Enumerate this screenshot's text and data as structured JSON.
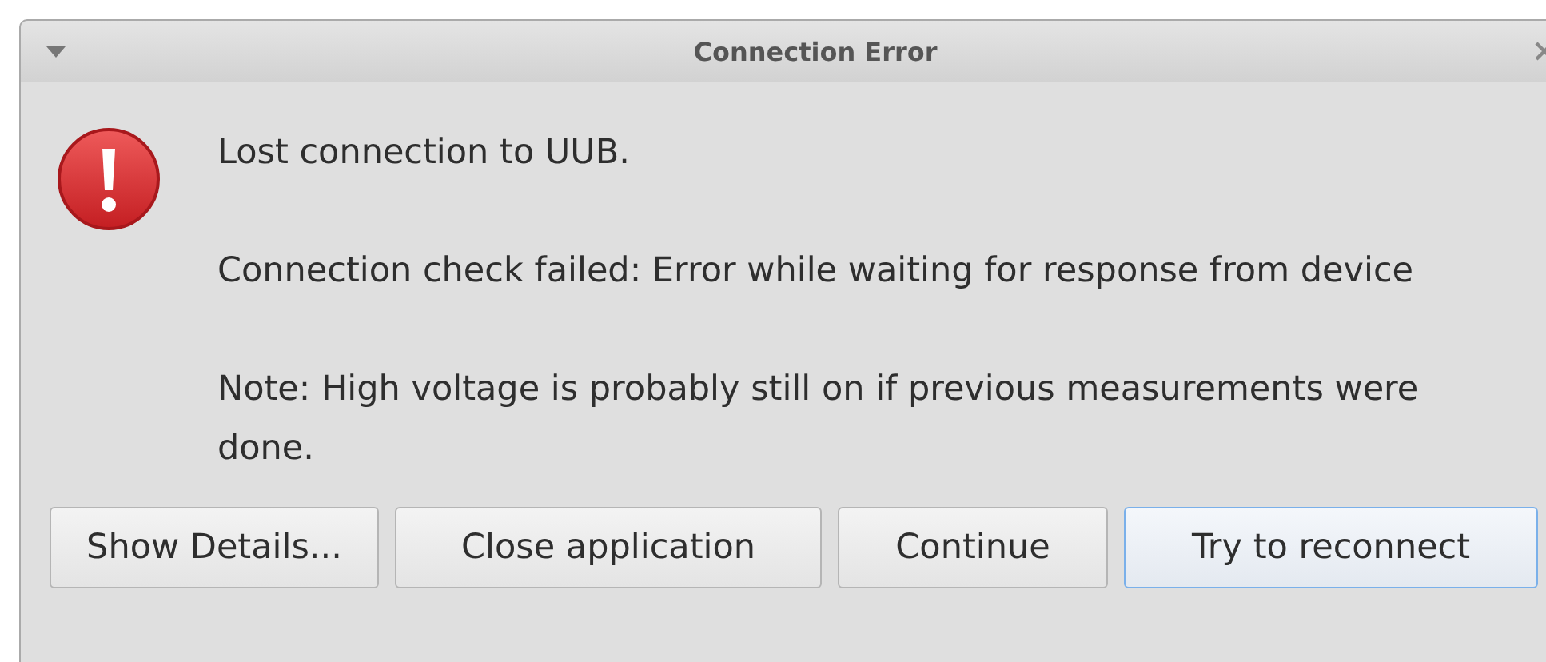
{
  "window": {
    "title": "Connection Error"
  },
  "messages": [
    "Lost connection to UUB.",
    "Connection check failed: Error while waiting for response from device",
    "Note: High voltage is probably still on if previous measurements were done."
  ],
  "buttons": [
    {
      "label": "Show Details...",
      "default": false
    },
    {
      "label": "Close application",
      "default": false
    },
    {
      "label": "Continue",
      "default": false
    },
    {
      "label": "Try to reconnect",
      "default": true
    }
  ]
}
